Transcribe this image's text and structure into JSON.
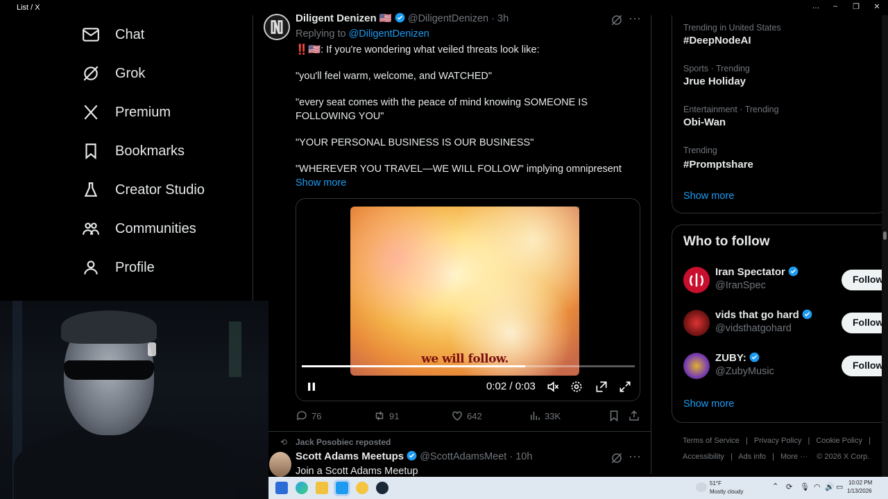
{
  "window": {
    "title": "List / X",
    "controls": [
      "…",
      "–",
      "❐",
      "✕"
    ]
  },
  "nav": [
    {
      "id": "chat",
      "label": "Chat",
      "icon": "mail-icon"
    },
    {
      "id": "grok",
      "label": "Grok",
      "icon": "grok-icon"
    },
    {
      "id": "premium",
      "label": "Premium",
      "icon": "x-logo-icon"
    },
    {
      "id": "bookmarks",
      "label": "Bookmarks",
      "icon": "bookmark-icon"
    },
    {
      "id": "creator",
      "label": "Creator Studio",
      "icon": "flask-icon"
    },
    {
      "id": "communities",
      "label": "Communities",
      "icon": "people-icon"
    },
    {
      "id": "profile",
      "label": "Profile",
      "icon": "person-icon"
    }
  ],
  "tweet": {
    "author": "Diligent Denizen",
    "flag": "🇺🇸",
    "handle": "@DiligentDenizen",
    "time": "· 3h",
    "replying_prefix": "Replying to ",
    "replying_to": "@DiligentDenizen",
    "line1_emoji": "‼️🇺🇸",
    "line1": ": If you're wondering what veiled threats look like:",
    "quote1": "\"you'll feel warm, welcome, and WATCHED\"",
    "quote2a": "\"every seat comes with the peace of mind knowing SOMEONE IS",
    "quote2b": "FOLLOWING YOU\"",
    "quote3": "\"YOUR PERSONAL BUSINESS IS OUR BUSINESS\"",
    "quote4": "\"WHEREVER YOU TRAVEL—WE WILL FOLLOW\" implying omnipresent",
    "show_more": "Show more",
    "video": {
      "caption": "we will follow.",
      "time": "0:02 / 0:03",
      "progress": 0.67
    },
    "stats": {
      "replies": "76",
      "reposts": "91",
      "likes": "642",
      "views": "33K"
    }
  },
  "next_tweet": {
    "reposted_by": "Jack Posobiec reposted",
    "author": "Scott Adams Meetups",
    "handle": "@ScottAdamsMeet",
    "time": "· 10h",
    "text": "Join a Scott Adams Meetup"
  },
  "trends": [
    {
      "category": "Trending in United States",
      "name": "#DeepNodeAI"
    },
    {
      "category": "Sports · Trending",
      "name": "Jrue Holiday"
    },
    {
      "category": "Entertainment · Trending",
      "name": "Obi-Wan"
    },
    {
      "category": "Trending",
      "name": "#Promptshare"
    }
  ],
  "trends_show_more": "Show more",
  "who_to_follow": {
    "title": "Who to follow",
    "follow_label": "Follow",
    "show_more": "Show more",
    "accounts": [
      {
        "name": "Iran Spectator",
        "handle": "@IranSpec",
        "avatar_color": "#c8102e"
      },
      {
        "name": "vids that go hard",
        "handle": "@vidsthatgohard",
        "avatar_color": "#8a1a1a"
      },
      {
        "name": "ZUBY:",
        "handle": "@ZubyMusic",
        "avatar_color": "#7a3fb0"
      }
    ]
  },
  "footer": {
    "links": [
      "Terms of Service",
      "Privacy Policy",
      "Cookie Policy",
      "Accessibility",
      "Ads info",
      "More ···"
    ],
    "copyright": "© 2026 X Corp."
  },
  "taskbar": {
    "weather_temp": "51°F",
    "weather_desc": "Mostly cloudy",
    "time": "10:02 PM",
    "date": "1/13/2026"
  },
  "colors": {
    "accent": "#1d9bf0",
    "bg": "#000000",
    "border": "#2f3336",
    "muted": "#71767b"
  }
}
